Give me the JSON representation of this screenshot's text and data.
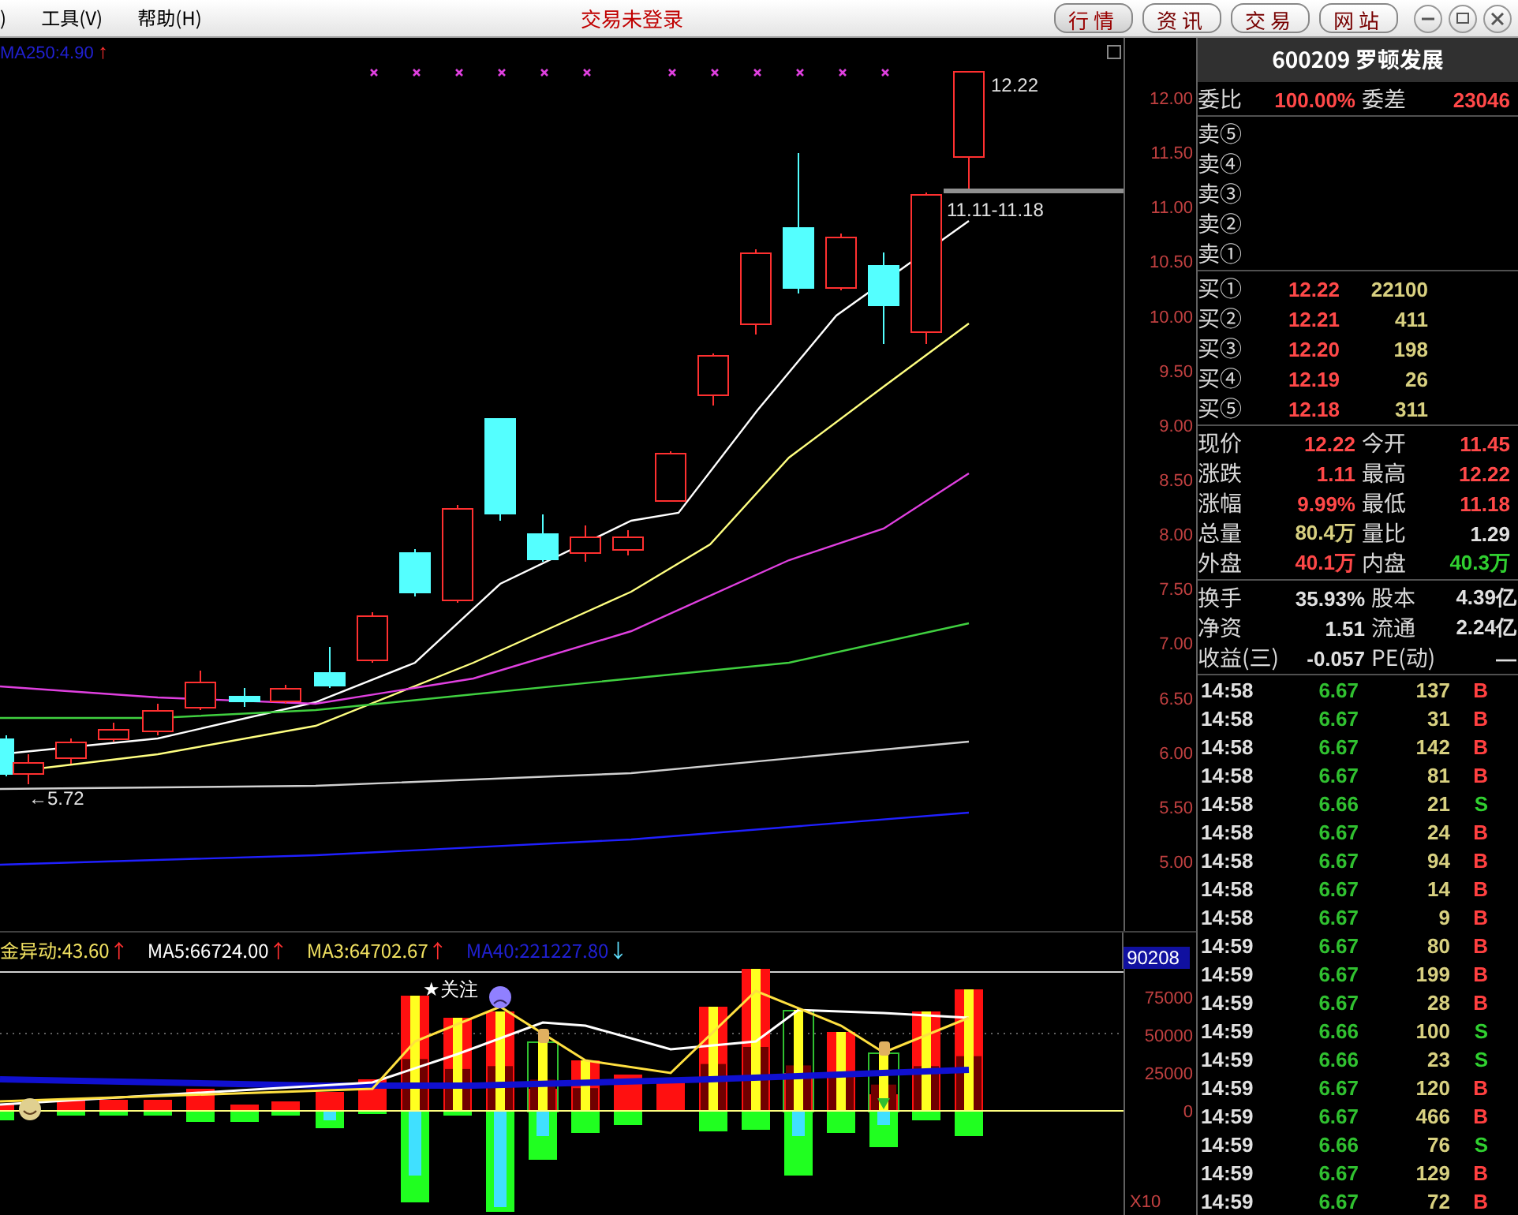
{
  "menu": [
    {
      "label": ")"
    },
    {
      "label": "工具(V)"
    },
    {
      "label": "帮助(H)"
    }
  ],
  "status": "交易未登录",
  "nav_buttons": [
    {
      "label": "行情",
      "selected": true
    },
    {
      "label": "资讯",
      "selected": false
    },
    {
      "label": "交易",
      "selected": false
    },
    {
      "label": "网站",
      "selected": false
    }
  ],
  "price_chart": {
    "legend": {
      "text": "MA250:4.90",
      "arrow": {
        "text": "↑",
        "color": "#ff3030"
      }
    },
    "axis": [
      "12.00",
      "11.50",
      "11.00",
      "10.50",
      "10.00",
      "9.50",
      "9.00",
      "8.50",
      "8.00",
      "7.50",
      "7.00",
      "6.50",
      "6.00",
      "5.50",
      "5.00"
    ],
    "high_label": "12.22",
    "range_label": "11.11-11.18",
    "low_label": "←5.72"
  },
  "indicator": {
    "legends": [
      {
        "text": "金异动:43.60",
        "arrow": {
          "text": "↑",
          "color": "#ff3030"
        },
        "color": "#f0e060"
      },
      {
        "text": "MA5:66724.00",
        "arrow": {
          "text": "↑",
          "color": "#ff3030"
        },
        "color": "#ffffff"
      },
      {
        "text": "MA3:64702.67",
        "arrow": {
          "text": "↑",
          "color": "#ff3030"
        },
        "color": "#f0e060"
      },
      {
        "text": "MA40:221227.80",
        "arrow": {
          "text": "↓",
          "color": "#60e0ff"
        },
        "color": "#2020d0"
      }
    ],
    "value_tag": "90208",
    "axis": [
      "75000",
      "50000",
      "25000",
      "0"
    ],
    "note": "★关注",
    "scale": "X10"
  },
  "quote": {
    "title": "600209 罗顿发展",
    "ratio": {
      "label": "委比",
      "value": "100.00%",
      "label2": "委差",
      "value2": "23046"
    },
    "sell": [
      {
        "label": "卖⑤"
      },
      {
        "label": "卖④"
      },
      {
        "label": "卖③"
      },
      {
        "label": "卖②"
      },
      {
        "label": "卖①"
      }
    ],
    "buy": [
      {
        "label": "买①",
        "price": "12.22",
        "volume": "22100"
      },
      {
        "label": "买②",
        "price": "12.21",
        "volume": "411"
      },
      {
        "label": "买③",
        "price": "12.20",
        "volume": "198"
      },
      {
        "label": "买④",
        "price": "12.19",
        "volume": "26"
      },
      {
        "label": "买⑤",
        "price": "12.18",
        "volume": "311"
      }
    ],
    "stats": [
      {
        "cells": [
          {
            "label": "现价",
            "value": "12.22",
            "color": "#ff4848"
          },
          {
            "label": "今开",
            "value": "11.45",
            "color": "#ff4848"
          }
        ]
      },
      {
        "cells": [
          {
            "label": "涨跌",
            "value": "1.11",
            "color": "#ff4848"
          },
          {
            "label": "最高",
            "value": "12.22",
            "color": "#ff4848"
          }
        ]
      },
      {
        "cells": [
          {
            "label": "涨幅",
            "value": "9.99%",
            "color": "#ff4848"
          },
          {
            "label": "最低",
            "value": "11.18",
            "color": "#ff4848"
          }
        ]
      },
      {
        "cells": [
          {
            "label": "总量",
            "value": "80.4万",
            "color": "#d8d080"
          },
          {
            "label": "量比",
            "value": "1.29",
            "color": "#e0e0e0"
          }
        ]
      },
      {
        "cells": [
          {
            "label": "外盘",
            "value": "40.1万",
            "color": "#ff4848"
          },
          {
            "label": "内盘",
            "value": "40.3万",
            "color": "#30d030"
          }
        ]
      }
    ],
    "finance": [
      {
        "label": "换手",
        "value": "35.93%",
        "label2": "股本",
        "value2": "4.39亿"
      },
      {
        "label": "净资",
        "value": "1.51",
        "label2": "流通",
        "value2": "2.24亿"
      },
      {
        "label": "收益(三)",
        "value": "-0.057",
        "label2": "PE(动)",
        "value2": "—"
      }
    ],
    "ticks": [
      {
        "time": "14:58",
        "price": "6.67",
        "volume": "137",
        "side": "B",
        "kind": "buy"
      },
      {
        "time": "14:58",
        "price": "6.67",
        "volume": "31",
        "side": "B",
        "kind": "buy"
      },
      {
        "time": "14:58",
        "price": "6.67",
        "volume": "142",
        "side": "B",
        "kind": "buy"
      },
      {
        "time": "14:58",
        "price": "6.67",
        "volume": "81",
        "side": "B",
        "kind": "buy"
      },
      {
        "time": "14:58",
        "price": "6.66",
        "volume": "21",
        "side": "S",
        "kind": "sell"
      },
      {
        "time": "14:58",
        "price": "6.67",
        "volume": "24",
        "side": "B",
        "kind": "buy"
      },
      {
        "time": "14:58",
        "price": "6.67",
        "volume": "94",
        "side": "B",
        "kind": "buy"
      },
      {
        "time": "14:58",
        "price": "6.67",
        "volume": "14",
        "side": "B",
        "kind": "buy"
      },
      {
        "time": "14:58",
        "price": "6.67",
        "volume": "9",
        "side": "B",
        "kind": "buy"
      },
      {
        "time": "14:59",
        "price": "6.67",
        "volume": "80",
        "side": "B",
        "kind": "buy"
      },
      {
        "time": "14:59",
        "price": "6.67",
        "volume": "199",
        "side": "B",
        "kind": "buy"
      },
      {
        "time": "14:59",
        "price": "6.67",
        "volume": "28",
        "side": "B",
        "kind": "buy"
      },
      {
        "time": "14:59",
        "price": "6.66",
        "volume": "100",
        "side": "S",
        "kind": "sell"
      },
      {
        "time": "14:59",
        "price": "6.66",
        "volume": "23",
        "side": "S",
        "kind": "sell"
      },
      {
        "time": "14:59",
        "price": "6.67",
        "volume": "120",
        "side": "B",
        "kind": "buy"
      },
      {
        "time": "14:59",
        "price": "6.67",
        "volume": "466",
        "side": "B",
        "kind": "buy"
      },
      {
        "time": "14:59",
        "price": "6.66",
        "volume": "76",
        "side": "S",
        "kind": "sell"
      },
      {
        "time": "14:59",
        "price": "6.67",
        "volume": "129",
        "side": "B",
        "kind": "buy"
      },
      {
        "time": "14:59",
        "price": "6.67",
        "volume": "72",
        "side": "B",
        "kind": "buy"
      }
    ]
  }
}
